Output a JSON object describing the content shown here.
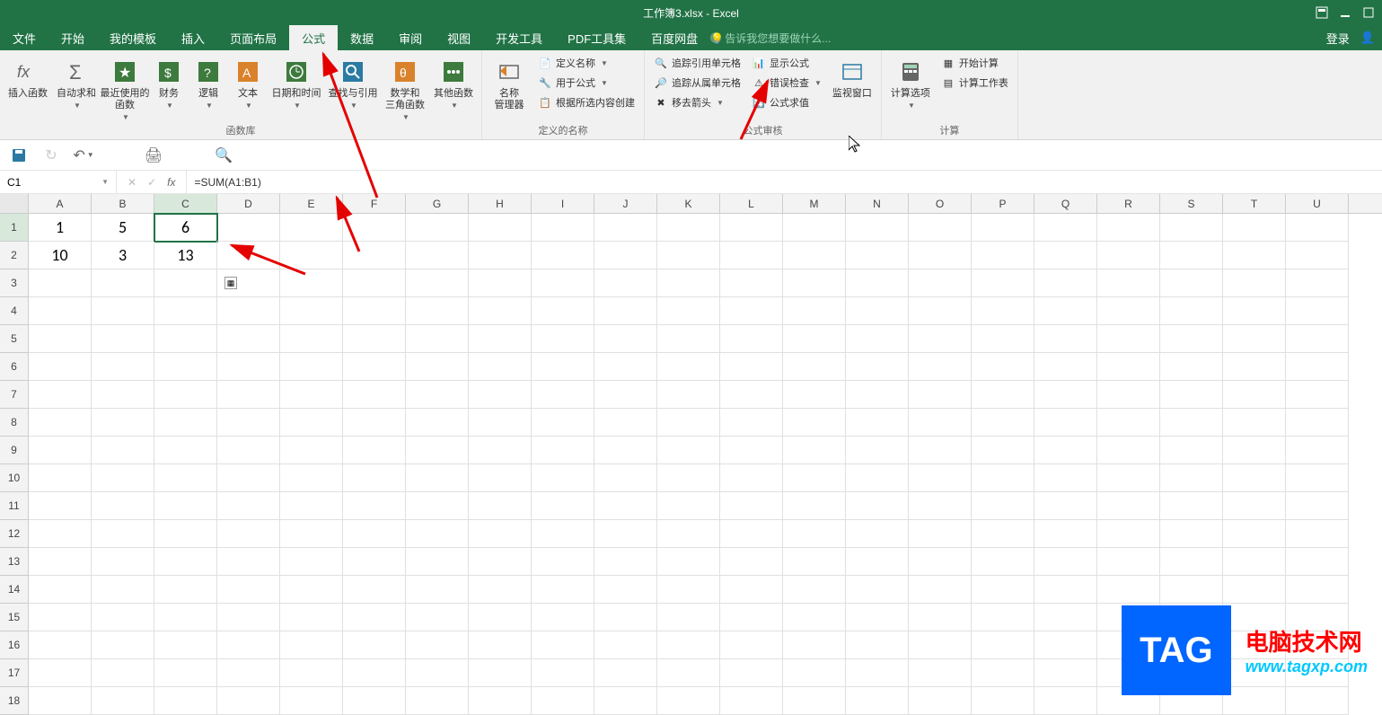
{
  "title": "工作簿3.xlsx - Excel",
  "login": "登录",
  "tabs": [
    "文件",
    "开始",
    "我的模板",
    "插入",
    "页面布局",
    "公式",
    "数据",
    "审阅",
    "视图",
    "开发工具",
    "PDF工具集",
    "百度网盘"
  ],
  "active_tab": "公式",
  "tell_me": "告诉我您想要做什么...",
  "ribbon": {
    "group1": {
      "label": "函数库",
      "insert_fn": "插入函数",
      "autosum": "自动求和",
      "recent": "最近使用的\n函数",
      "financial": "财务",
      "logical": "逻辑",
      "text": "文本",
      "datetime": "日期和时间",
      "lookup": "查找与引用",
      "math": "数学和\n三角函数",
      "other": "其他函数"
    },
    "group2": {
      "label": "定义的名称",
      "manager": "名称\n管理器",
      "define": "定义名称",
      "useinf": "用于公式",
      "create": "根据所选内容创建"
    },
    "group3": {
      "label": "公式审核",
      "trace_prec": "追踪引用单元格",
      "trace_dep": "追踪从属单元格",
      "remove_arrows": "移去箭头",
      "show_formulas": "显示公式",
      "error_check": "错误检查",
      "evaluate": "公式求值",
      "watch": "监视窗口"
    },
    "group4": {
      "label": "计算",
      "options": "计算选项",
      "calc_now": "开始计算",
      "calc_sheet": "计算工作表"
    }
  },
  "name_box": "C1",
  "formula": "=SUM(A1:B1)",
  "columns": [
    "A",
    "B",
    "C",
    "D",
    "E",
    "F",
    "G",
    "H",
    "I",
    "J",
    "K",
    "L",
    "M",
    "N",
    "O",
    "P",
    "Q",
    "R",
    "S",
    "T",
    "U"
  ],
  "rows": [
    1,
    2,
    3,
    4,
    5,
    6,
    7,
    8,
    9,
    10,
    11,
    12,
    13,
    14,
    15,
    16,
    17,
    18
  ],
  "cells": {
    "A1": "1",
    "B1": "5",
    "C1": "6",
    "A2": "10",
    "B2": "3",
    "C2": "13"
  },
  "selected_cell": "C1",
  "watermark": {
    "tag": "TAG",
    "line1": "电脑技术网",
    "line2": "www.tagxp.com"
  }
}
